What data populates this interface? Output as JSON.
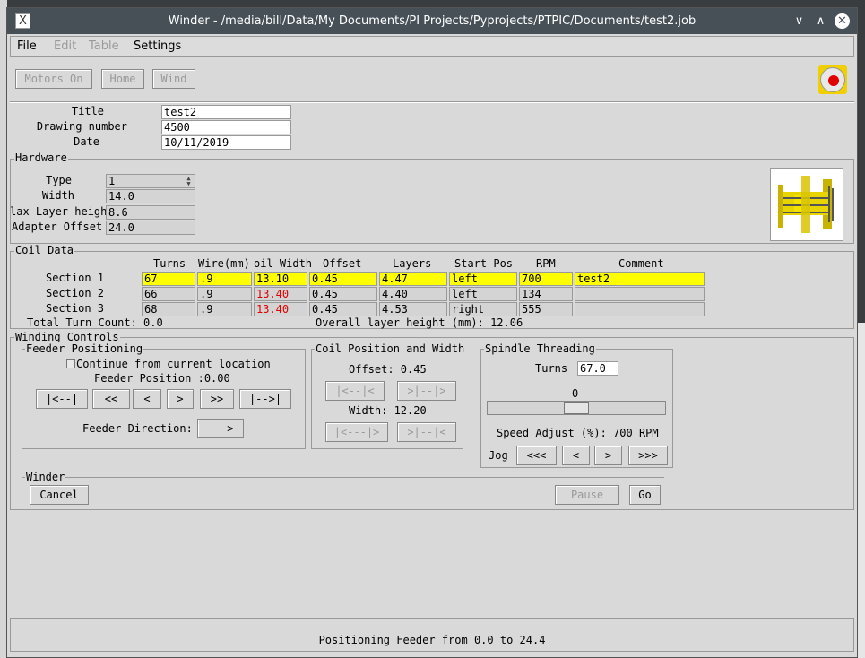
{
  "window": {
    "title": "Winder - /media/bill/Data/My Documents/PI Projects/Pyprojects/PTPIC/Documents/test2.job",
    "app_icon": "x-logo-icon",
    "min_icon": "∨",
    "max_icon": "∧",
    "close_icon": "✕"
  },
  "menu": {
    "file": "File",
    "edit": "Edit",
    "table": "Table",
    "settings": "Settings"
  },
  "toolbar": {
    "motors_on": "Motors On",
    "home": "Home",
    "wind": "Wind",
    "estop_text": "EMERGENCY STOP"
  },
  "job": {
    "title_label": "Title",
    "title_value": "test2",
    "drawing_label": "Drawing number",
    "drawing_value": "4500",
    "date_label": "Date",
    "date_value": "10/11/2019"
  },
  "hardware": {
    "legend": "Hardware",
    "type_label": "Type",
    "type_value": "1",
    "width_label": "Width",
    "width_value": "14.0",
    "max_layer_label": "lax Layer height",
    "max_layer_value": "8.6",
    "adapter_label": "Adapter Offset",
    "adapter_value": "24.0"
  },
  "coil": {
    "legend": "Coil Data",
    "headers": [
      "Turns",
      "Wire(mm)",
      "oil Width",
      "Offset",
      "Layers",
      "Start Pos",
      "RPM",
      "Comment"
    ],
    "rows": [
      {
        "label": "Section 1",
        "turns": "67",
        "wire": ".9",
        "width": "13.10",
        "offset": "0.45",
        "layers": "4.47",
        "start": "left",
        "rpm": "700",
        "comment": "test2"
      },
      {
        "label": "Section 2",
        "turns": "66",
        "wire": ".9",
        "width": "13.40",
        "offset": "0.45",
        "layers": "4.40",
        "start": "left",
        "rpm": "134",
        "comment": ""
      },
      {
        "label": "Section 3",
        "turns": "68",
        "wire": ".9",
        "width": "13.40",
        "offset": "0.45",
        "layers": "4.53",
        "start": "right",
        "rpm": "555",
        "comment": ""
      }
    ],
    "total_turns": "Total Turn Count: 0.0",
    "overall_layer": "Overall layer height (mm): 12.06",
    "highlight_color": "#ffff00",
    "warn_color": "#e00000"
  },
  "winding": {
    "legend": "Winding Controls",
    "feeder": {
      "legend": "Feeder Positioning",
      "continue_label": "Continue from current location",
      "position": "Feeder Position :0.00",
      "btn_far_left": "|<--|",
      "btn_left2": "<<",
      "btn_left": "<",
      "btn_right": ">",
      "btn_right2": ">>",
      "btn_far_right": "|-->|",
      "direction_label": "Feeder Direction:",
      "direction_btn": "--->"
    },
    "coilpos": {
      "legend": "Coil Position and Width",
      "offset": "Offset: 0.45",
      "off_left": "|<--|<",
      "off_right": ">|--|>",
      "width": "Width: 12.20",
      "w_left": "|<---|>",
      "w_right": ">|--|<"
    },
    "spindle": {
      "legend": "Spindle Threading",
      "turns_label": "Turns",
      "turns_value": "67.0",
      "slider_value": "0",
      "speed": "Speed Adjust (%): 700 RPM",
      "jog_label": "Jog",
      "jog_ll": "<<<",
      "jog_l": "<",
      "jog_r": ">",
      "jog_rr": ">>>"
    }
  },
  "winder": {
    "legend": "Winder",
    "cancel": "Cancel",
    "pause": "Pause",
    "go": "Go"
  },
  "status": {
    "text": "Positioning Feeder from 0.0 to 24.4"
  }
}
